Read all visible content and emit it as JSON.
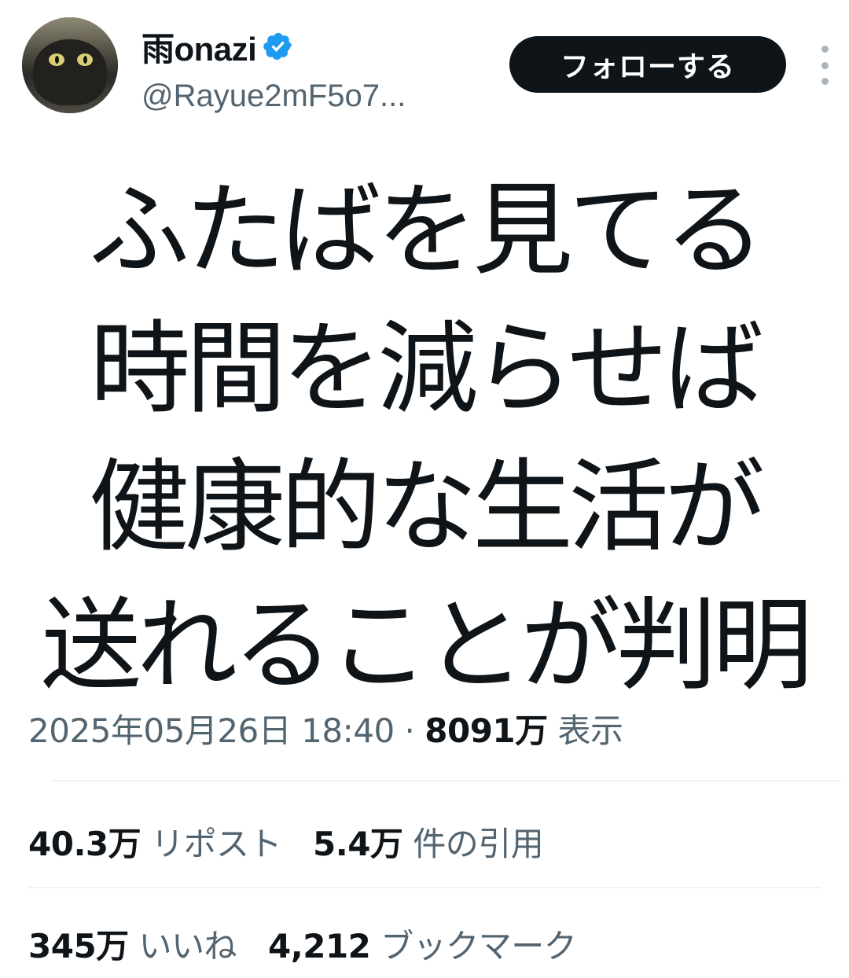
{
  "author": {
    "display_name": "雨onazi",
    "handle": "@Rayue2mF5o7...",
    "verified": true
  },
  "actions": {
    "follow_label": "フォローする"
  },
  "tweet": {
    "lines": [
      "ふたばを見てる",
      "時間を減らせば",
      "健康的な生活が",
      "送れることが判明"
    ],
    "timestamp": "2025年05月26日 18:40",
    "separator": "·",
    "views_count": "8091万",
    "views_label": "表示"
  },
  "stats": {
    "reposts_count": "40.3万",
    "reposts_label": "リポスト",
    "quotes_count": "5.4万",
    "quotes_label": "件の引用",
    "likes_count": "345万",
    "likes_label": "いいね",
    "bookmarks_count": "4,212",
    "bookmarks_label": "ブックマーク"
  },
  "colors": {
    "text_primary": "#0f1419",
    "text_secondary": "#536471",
    "verified_blue": "#1d9bf0",
    "follow_bg": "#0f1419",
    "divider": "#eff3f4"
  },
  "icons": {
    "verified": "verified-badge-icon",
    "more": "more-vertical-icon"
  }
}
